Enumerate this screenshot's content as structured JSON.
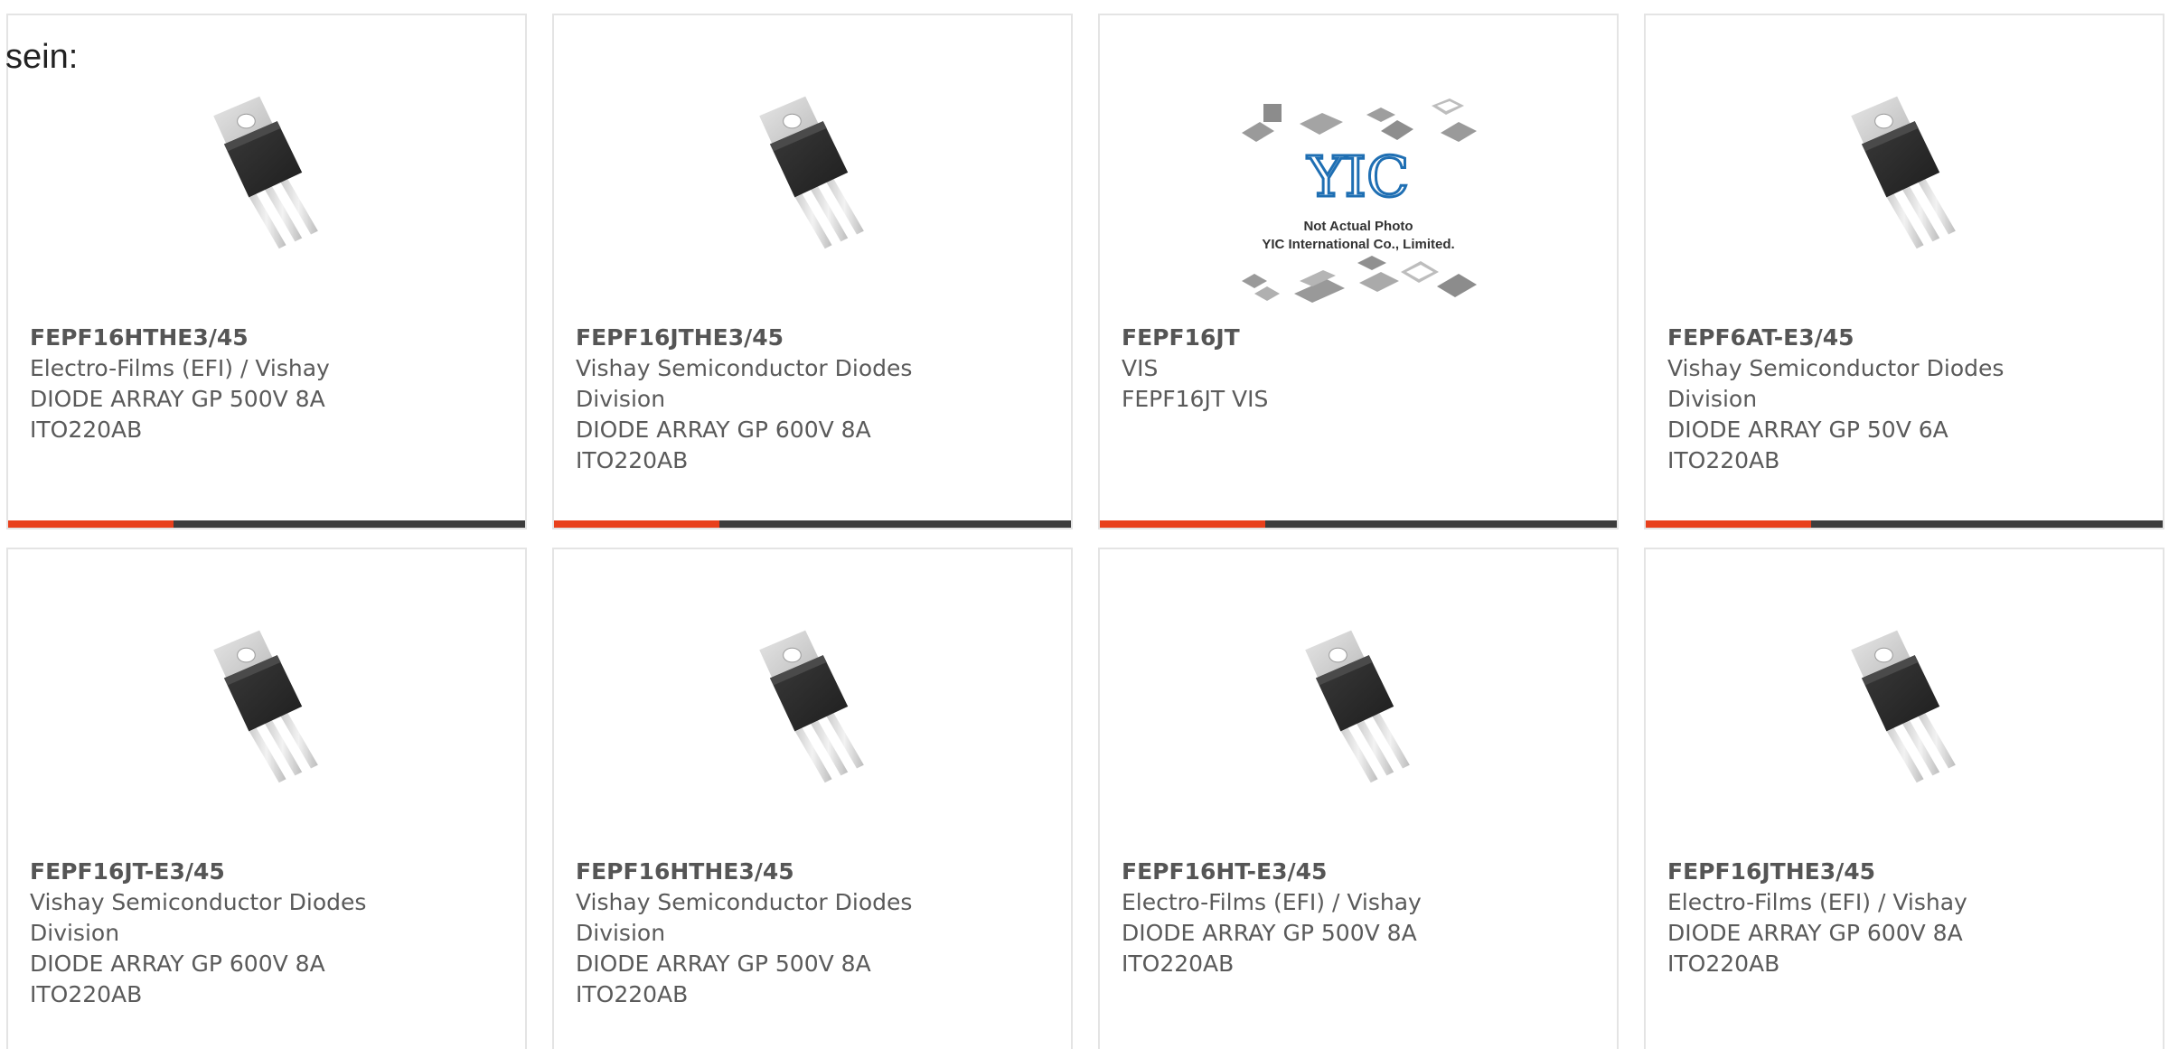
{
  "intro_text": "sein:",
  "accent_color": "#e8401c",
  "bar_color": "#3d3d3d",
  "products": [
    {
      "part": "FEPF16HTHE3/45",
      "maker": "Electro-Films (EFI) / Vishay",
      "maker2": "",
      "desc": "DIODE ARRAY GP 500V 8A",
      "pkg": "ITO220AB",
      "image": "to220-transistor-image"
    },
    {
      "part": "FEPF16JTHE3/45",
      "maker": "Vishay Semiconductor Diodes",
      "maker2": "Division",
      "desc": "DIODE ARRAY GP 600V 8A",
      "pkg": "ITO220AB",
      "image": "to220-transistor-image"
    },
    {
      "part": "FEPF16JT",
      "maker": "VIS",
      "maker2": "",
      "desc": "FEPF16JT VIS",
      "pkg": "",
      "image": "yic-placeholder-image",
      "placeholder_brand": "YIC",
      "placeholder_line1": "Not Actual Photo",
      "placeholder_line2": "YIC International Co., Limited."
    },
    {
      "part": "FEPF6AT-E3/45",
      "maker": "Vishay Semiconductor Diodes",
      "maker2": "Division",
      "desc": "DIODE ARRAY GP 50V 6A",
      "pkg": "ITO220AB",
      "image": "to220-transistor-image"
    },
    {
      "part": "FEPF16JT-E3/45",
      "maker": "Vishay Semiconductor Diodes",
      "maker2": "Division",
      "desc": "DIODE ARRAY GP 600V 8A",
      "pkg": "ITO220AB",
      "image": "to220-transistor-image"
    },
    {
      "part": "FEPF16HTHE3/45",
      "maker": "Vishay Semiconductor Diodes",
      "maker2": "Division",
      "desc": "DIODE ARRAY GP 500V 8A",
      "pkg": "ITO220AB",
      "image": "to220-transistor-image"
    },
    {
      "part": "FEPF16HT-E3/45",
      "maker": "Electro-Films (EFI) / Vishay",
      "maker2": "",
      "desc": "DIODE ARRAY GP 500V 8A",
      "pkg": "ITO220AB",
      "image": "to220-transistor-image"
    },
    {
      "part": "FEPF16JTHE3/45",
      "maker": "Electro-Films (EFI) / Vishay",
      "maker2": "",
      "desc": "DIODE ARRAY GP 600V 8A",
      "pkg": "ITO220AB",
      "image": "to220-transistor-image"
    }
  ]
}
